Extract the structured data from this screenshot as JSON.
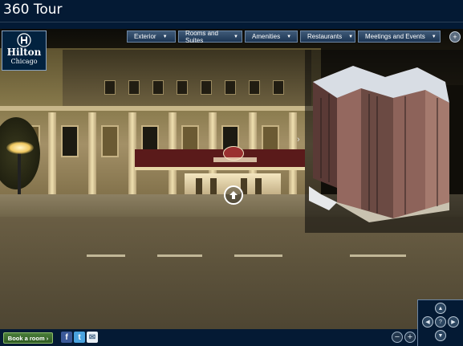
{
  "window": {
    "title": "360 Tour"
  },
  "logo": {
    "brand": "Hilton",
    "city": "Chicago"
  },
  "nav": {
    "items": [
      {
        "label": "Exterior"
      },
      {
        "label": "Rooms and Suites"
      },
      {
        "label": "Amenities"
      },
      {
        "label": "Restaurants"
      },
      {
        "label": "Meetings and Events"
      }
    ]
  },
  "icons": {
    "fullscreen": "fullscreen-icon",
    "hotspot": "arrow-up-icon",
    "facebook": "facebook-icon",
    "twitter": "twitter-icon",
    "email": "email-icon",
    "zoom_out": "zoom-out-icon",
    "zoom_in": "zoom-in-icon",
    "help": "help-icon"
  },
  "glyphs": {
    "fullscreen": "+",
    "facebook": "f",
    "twitter": "t",
    "email": "✉",
    "zoom_out": "−",
    "zoom_in": "+",
    "help": "?",
    "pan_up": "▲",
    "pan_down": "▼",
    "pan_left": "◀",
    "pan_right": "▶",
    "map_toggle": "›"
  },
  "footer": {
    "book_label": "Book a room ›"
  },
  "colors": {
    "header_bg": "#041a34",
    "book_green": "#3f6f31",
    "nav_bg": "#2b4560"
  }
}
